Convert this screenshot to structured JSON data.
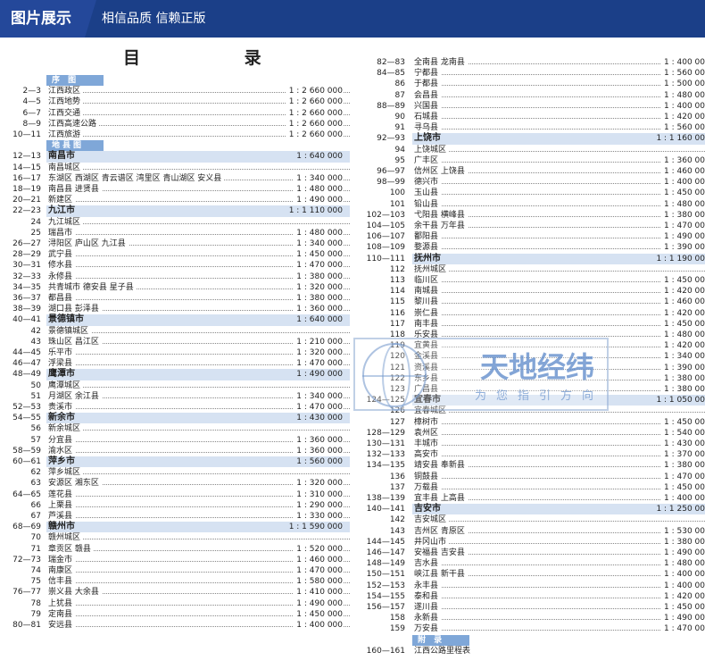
{
  "banner": {
    "tag": "图片展示",
    "slogan": "相信品质 信赖正版"
  },
  "title": "目  录",
  "left_column": [
    {
      "type": "sec",
      "name": "序 图"
    },
    {
      "page": "2—3",
      "name": "江西政区",
      "scale": "1 : 2 660 000"
    },
    {
      "page": "4—5",
      "name": "江西地势",
      "scale": "1 : 2 660 000"
    },
    {
      "page": "6—7",
      "name": "江西交通",
      "scale": "1 : 2 660 000"
    },
    {
      "page": "8—9",
      "name": "江西高速公路",
      "scale": "1 : 2 660 000"
    },
    {
      "page": "10—11",
      "name": "江西旅游",
      "scale": "1 : 2 660 000"
    },
    {
      "type": "sec",
      "name": "地县图"
    },
    {
      "type": "city",
      "page": "12—13",
      "name": "南昌市",
      "scale": "1 : 640 000"
    },
    {
      "page": "14—15",
      "name": "南昌城区",
      "scale": ""
    },
    {
      "page": "16—17",
      "name": "东湖区 西湖区 青云谱区 湾里区 青山湖区 安义县",
      "scale": "1 : 340 000"
    },
    {
      "page": "18—19",
      "name": "南昌县 进贤县",
      "scale": "1 : 480 000"
    },
    {
      "page": "20—21",
      "name": "新建区",
      "scale": "1 : 490 000"
    },
    {
      "type": "city",
      "page": "22—23",
      "name": "九江市",
      "scale": "1 : 1 110 000"
    },
    {
      "page": "24",
      "name": "九江城区",
      "scale": ""
    },
    {
      "page": "25",
      "name": "瑞昌市",
      "scale": "1 : 480 000"
    },
    {
      "page": "26—27",
      "name": "浔阳区 庐山区 九江县",
      "scale": "1 : 340 000"
    },
    {
      "page": "28—29",
      "name": "武宁县",
      "scale": "1 : 450 000"
    },
    {
      "page": "30—31",
      "name": "修水县",
      "scale": "1 : 470 000"
    },
    {
      "page": "32—33",
      "name": "永修县",
      "scale": "1 : 380 000"
    },
    {
      "page": "34—35",
      "name": "共青城市 德安县 星子县",
      "scale": "1 : 320 000"
    },
    {
      "page": "36—37",
      "name": "都昌县",
      "scale": "1 : 380 000"
    },
    {
      "page": "38—39",
      "name": "湖口县 彭泽县",
      "scale": "1 : 360 000"
    },
    {
      "type": "city",
      "page": "40—41",
      "name": "景德镇市",
      "scale": "1 : 640 000"
    },
    {
      "page": "42",
      "name": "景德镇城区",
      "scale": ""
    },
    {
      "page": "43",
      "name": "珠山区 昌江区",
      "scale": "1 : 210 000"
    },
    {
      "page": "44—45",
      "name": "乐平市",
      "scale": "1 : 320 000"
    },
    {
      "page": "46—47",
      "name": "浮梁县",
      "scale": "1 : 470 000"
    },
    {
      "type": "city",
      "page": "48—49",
      "name": "鹰潭市",
      "scale": "1 : 490 000"
    },
    {
      "page": "50",
      "name": "鹰潭城区",
      "scale": ""
    },
    {
      "page": "51",
      "name": "月湖区 余江县",
      "scale": "1 : 340 000"
    },
    {
      "page": "52—53",
      "name": "贵溪市",
      "scale": "1 : 470 000"
    },
    {
      "type": "city",
      "page": "54—55",
      "name": "新余市",
      "scale": "1 : 430 000"
    },
    {
      "page": "56",
      "name": "新余城区",
      "scale": ""
    },
    {
      "page": "57",
      "name": "分宜县",
      "scale": "1 : 360 000"
    },
    {
      "page": "58—59",
      "name": "渝水区",
      "scale": "1 : 360 000"
    },
    {
      "type": "city",
      "page": "60—61",
      "name": "萍乡市",
      "scale": "1 : 560 000"
    },
    {
      "page": "62",
      "name": "萍乡城区",
      "scale": ""
    },
    {
      "page": "63",
      "name": "安源区 湘东区",
      "scale": "1 : 320 000"
    },
    {
      "page": "64—65",
      "name": "莲花县",
      "scale": "1 : 310 000"
    },
    {
      "page": "66",
      "name": "上栗县",
      "scale": "1 : 290 000"
    },
    {
      "page": "67",
      "name": "芦溪县",
      "scale": "1 : 330 000"
    },
    {
      "type": "city",
      "page": "68—69",
      "name": "赣州市",
      "scale": "1 : 1 590 000"
    },
    {
      "page": "70",
      "name": "赣州城区",
      "scale": ""
    },
    {
      "page": "71",
      "name": "章贡区 赣县",
      "scale": "1 : 520 000"
    },
    {
      "page": "72—73",
      "name": "瑞金市",
      "scale": "1 : 460 000"
    },
    {
      "page": "74",
      "name": "南康区",
      "scale": "1 : 470 000"
    },
    {
      "page": "75",
      "name": "信丰县",
      "scale": "1 : 580 000"
    },
    {
      "page": "76—77",
      "name": "崇义县 大余县",
      "scale": "1 : 410 000"
    },
    {
      "page": "78",
      "name": "上犹县",
      "scale": "1 : 490 000"
    },
    {
      "page": "79",
      "name": "定南县",
      "scale": "1 : 450 000"
    },
    {
      "page": "80—81",
      "name": "安远县",
      "scale": "1 : 400 000"
    }
  ],
  "right_column": [
    {
      "page": "82—83",
      "name": "全南县 龙南县",
      "scale": "1 : 400 00"
    },
    {
      "page": "84—85",
      "name": "宁都县",
      "scale": "1 : 560 00"
    },
    {
      "page": "86",
      "name": "于都县",
      "scale": "1 : 500 00"
    },
    {
      "page": "87",
      "name": "会昌县",
      "scale": "1 : 480 00"
    },
    {
      "page": "88—89",
      "name": "兴国县",
      "scale": "1 : 400 00"
    },
    {
      "page": "90",
      "name": "石城县",
      "scale": "1 : 420 00"
    },
    {
      "page": "91",
      "name": "寻乌县",
      "scale": "1 : 560 00"
    },
    {
      "type": "city",
      "page": "92—93",
      "name": "上饶市",
      "scale": "1 : 1 160 00"
    },
    {
      "page": "94",
      "name": "上饶城区",
      "scale": ""
    },
    {
      "page": "95",
      "name": "广丰区",
      "scale": "1 : 360 00"
    },
    {
      "page": "96—97",
      "name": "信州区 上饶县",
      "scale": "1 : 460 00"
    },
    {
      "page": "98—99",
      "name": "德兴市",
      "scale": "1 : 400 00"
    },
    {
      "page": "100",
      "name": "玉山县",
      "scale": "1 : 450 00"
    },
    {
      "page": "101",
      "name": "铅山县",
      "scale": "1 : 480 00"
    },
    {
      "page": "102—103",
      "name": "弋阳县 横峰县",
      "scale": "1 : 380 00"
    },
    {
      "page": "104—105",
      "name": "余干县 万年县",
      "scale": "1 : 470 00"
    },
    {
      "page": "106—107",
      "name": "鄱阳县",
      "scale": "1 : 490 00"
    },
    {
      "page": "108—109",
      "name": "婺源县",
      "scale": "1 : 390 00"
    },
    {
      "type": "city",
      "page": "110—111",
      "name": "抚州市",
      "scale": "1 : 1 190 00"
    },
    {
      "page": "112",
      "name": "抚州城区",
      "scale": ""
    },
    {
      "page": "113",
      "name": "临川区",
      "scale": "1 : 450 00"
    },
    {
      "page": "114",
      "name": "南城县",
      "scale": "1 : 420 00"
    },
    {
      "page": "115",
      "name": "黎川县",
      "scale": "1 : 460 00"
    },
    {
      "page": "116",
      "name": "崇仁县",
      "scale": "1 : 420 00"
    },
    {
      "page": "117",
      "name": "南丰县",
      "scale": "1 : 450 00"
    },
    {
      "page": "118",
      "name": "乐安县",
      "scale": "1 : 480 00"
    },
    {
      "page": "119",
      "name": "宜黄县",
      "scale": "1 : 420 00"
    },
    {
      "page": "120",
      "name": "金溪县",
      "scale": "1 : 340 00"
    },
    {
      "page": "121",
      "name": "资溪县",
      "scale": "1 : 390 00"
    },
    {
      "page": "122",
      "name": "东乡县",
      "scale": "1 : 380 00"
    },
    {
      "page": "123",
      "name": "广昌县",
      "scale": "1 : 380 00"
    },
    {
      "type": "city",
      "page": "124—125",
      "name": "宜春市",
      "scale": "1 : 1 050 00"
    },
    {
      "page": "126",
      "name": "宜春城区",
      "scale": ""
    },
    {
      "page": "127",
      "name": "樟树市",
      "scale": "1 : 450 00"
    },
    {
      "page": "128—129",
      "name": "袁州区",
      "scale": "1 : 540 00"
    },
    {
      "page": "130—131",
      "name": "丰城市",
      "scale": "1 : 430 00"
    },
    {
      "page": "132—133",
      "name": "高安市",
      "scale": "1 : 370 00"
    },
    {
      "page": "134—135",
      "name": "靖安县 奉新县",
      "scale": "1 : 380 00"
    },
    {
      "page": "136",
      "name": "铜鼓县",
      "scale": "1 : 470 00"
    },
    {
      "page": "137",
      "name": "万载县",
      "scale": "1 : 450 00"
    },
    {
      "page": "138—139",
      "name": "宜丰县 上高县",
      "scale": "1 : 400 00"
    },
    {
      "type": "city",
      "page": "140—141",
      "name": "吉安市",
      "scale": "1 : 1 250 00"
    },
    {
      "page": "142",
      "name": "吉安城区",
      "scale": ""
    },
    {
      "page": "143",
      "name": "吉州区 青原区",
      "scale": "1 : 530 00"
    },
    {
      "page": "144—145",
      "name": "井冈山市",
      "scale": "1 : 380 00"
    },
    {
      "page": "146—147",
      "name": "安福县 吉安县",
      "scale": "1 : 490 00"
    },
    {
      "page": "148—149",
      "name": "吉水县",
      "scale": "1 : 480 00"
    },
    {
      "page": "150—151",
      "name": "峡江县 新干县",
      "scale": "1 : 400 00"
    },
    {
      "page": "152—153",
      "name": "永丰县",
      "scale": "1 : 400 00"
    },
    {
      "page": "154—155",
      "name": "泰和县",
      "scale": "1 : 420 00"
    },
    {
      "page": "156—157",
      "name": "遂川县",
      "scale": "1 : 450 00"
    },
    {
      "page": "158",
      "name": "永新县",
      "scale": "1 : 490 00"
    },
    {
      "page": "159",
      "name": "万安县",
      "scale": "1 : 470 00"
    },
    {
      "type": "sec",
      "name": "附 录"
    },
    {
      "type": "plain",
      "page": "160—161",
      "name": "江西公路里程表",
      "scale": ""
    }
  ],
  "watermark": {
    "name": "天地经纬",
    "motto": "为您指引方向"
  }
}
